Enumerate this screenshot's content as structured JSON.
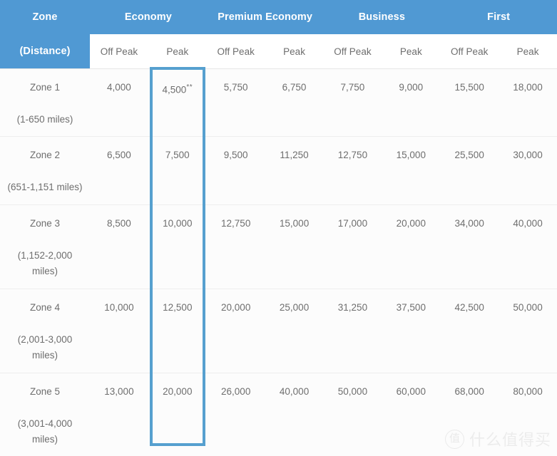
{
  "table": {
    "zone_header": {
      "line1": "Zone",
      "line2": "(Distance)"
    },
    "cabins": [
      {
        "label": "Economy"
      },
      {
        "label": "Premium Economy"
      },
      {
        "label": "Business"
      },
      {
        "label": "First"
      }
    ],
    "sub_headers": [
      "Off Peak",
      "Peak",
      "Off Peak",
      "Peak",
      "Off Peak",
      "Peak",
      "Off Peak",
      "Peak"
    ],
    "rows": [
      {
        "zone": "Zone 1",
        "distance": "(1-650 miles)",
        "values": [
          "4,000",
          "4,500",
          "5,750",
          "6,750",
          "7,750",
          "9,000",
          "15,500",
          "18,000"
        ],
        "footnote_marks": {
          "1": "**"
        }
      },
      {
        "zone": "Zone 2",
        "distance": "(651-1,151 miles)",
        "values": [
          "6,500",
          "7,500",
          "9,500",
          "11,250",
          "12,750",
          "15,000",
          "25,500",
          "30,000"
        ],
        "footnote_marks": {}
      },
      {
        "zone": "Zone 3",
        "distance": "(1,152-2,000 miles)",
        "values": [
          "8,500",
          "10,000",
          "12,750",
          "15,000",
          "17,000",
          "20,000",
          "34,000",
          "40,000"
        ],
        "footnote_marks": {}
      },
      {
        "zone": "Zone 4",
        "distance": "(2,001-3,000 miles)",
        "values": [
          "10,000",
          "12,500",
          "20,000",
          "25,000",
          "31,250",
          "37,500",
          "42,500",
          "50,000"
        ],
        "footnote_marks": {}
      },
      {
        "zone": "Zone 5",
        "distance": "(3,001-4,000 miles)",
        "values": [
          "13,000",
          "20,000",
          "26,000",
          "40,000",
          "50,000",
          "60,000",
          "68,000",
          "80,000"
        ],
        "footnote_marks": {}
      }
    ]
  },
  "highlight": {
    "column_label": "Economy Peak",
    "color": "#56a0cf"
  },
  "watermark": {
    "badge_glyph": "值",
    "text": "什么值得买"
  },
  "colors": {
    "header_blue": "#5099d3",
    "highlight_blue": "#56a0cf",
    "text_gray": "#6e6e6e",
    "cell_bg": "#fcfcfc"
  }
}
